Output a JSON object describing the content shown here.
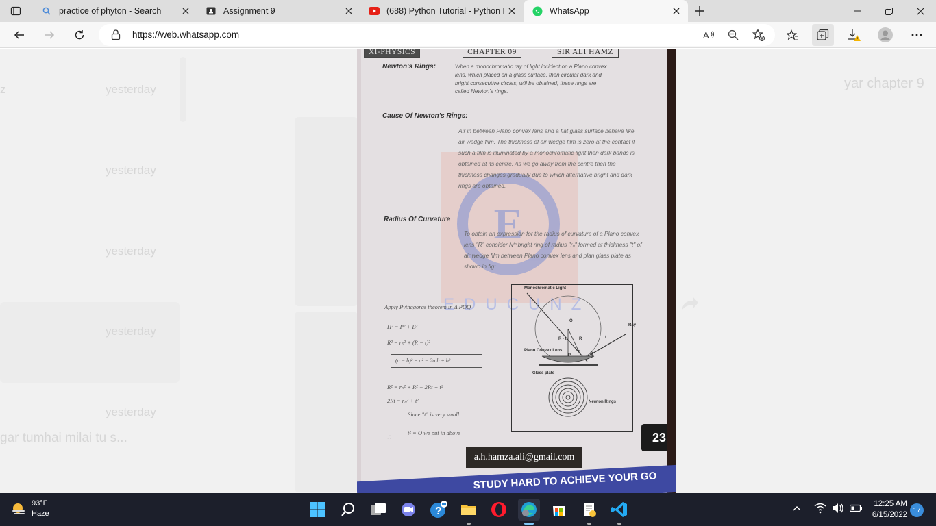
{
  "tabs": [
    {
      "title": "practice of phyton - Search",
      "icon": "search-icon"
    },
    {
      "title": "Assignment 9",
      "icon": "assignment-icon"
    },
    {
      "title": "(688) Python Tutorial - Python Fu",
      "icon": "youtube-icon"
    },
    {
      "title": "WhatsApp",
      "icon": "whatsapp-icon",
      "active": true
    }
  ],
  "address_bar": {
    "url": "https://web.whatsapp.com"
  },
  "background_chat": {
    "times": [
      "yesterday",
      "yesterday",
      "yesterday",
      "yesterday",
      "yesterday"
    ],
    "preview_left": "gar tumhai milai tu s...",
    "preview_right": "yar chapter 9",
    "left_edge_char": "z"
  },
  "document": {
    "header": [
      "XI-PHYSICS",
      "CHAPTER 09",
      "SIR ALI HAMZ"
    ],
    "newtons_rings_heading": "Newton's Rings:",
    "newtons_rings_text": "When a monochromatic ray of light incident on a Plano convex lens, which placed on a glass surface, then circular dark and bright consecutive circles, will be obtained, these rings are called Newton's rings.",
    "cause_heading": "Cause Of Newton's Rings:",
    "cause_text": "Air in between Plano convex lens and a flat glass surface behave like air wedge film. The thickness of air wedge film is zero at the contact if such a film is illuminated by a monochromatic light then dark bands is obtained at its centre. As we go away from the centre then the thickness changes gradually due to which alternative bright and dark rings are obtained.",
    "radius_heading": "Radius Of Curvature",
    "radius_text": "To obtain an expression for the radius of curvature of a Plano convex lens \"R\" consider Nᵗʰ bright ring of radius \"rₙ\" formed at thickness \"t\" of air wedge film between Plano convex lens and plan glass plate as shown in fig:",
    "pythagoras": "Apply Pythagoras theorem in Δ POQ",
    "eq1": "H² = P² + B²",
    "eq2": "R² = rₙ² + (R − t)²",
    "boxed": "(a − b)² = a² − 2a b + b²",
    "eq3": "R² = rₙ² + R² − 2Rt + t²",
    "eq4": "2Rt = rₙ² + t²",
    "since": "Since \"t\" is very small",
    "therefore_symbol": "∴",
    "t2": "t² = O  we put in above",
    "fig_labels": {
      "light": "Monochromatic Light",
      "lens": "Plano Convex Lens",
      "glass": "Glass plate",
      "rings": "Newton Rings",
      "o": "O",
      "r_minus_t": "R - t",
      "r": "R",
      "t": "t",
      "ray": "Ray",
      "rn": "rₙ",
      "p": "P",
      "q": "Q"
    },
    "watermark_letter": "E",
    "watermark_word": "EDUCUNZ",
    "page_number": "23",
    "email": "a.h.hamza.ali@gmail.com",
    "slogan": "STUDY HARD TO ACHIEVE YOUR GO"
  },
  "taskbar": {
    "weather_temp": "93°F",
    "weather_desc": "Haze",
    "time": "12:25 AM",
    "date": "6/15/2022",
    "notification_count": "17"
  }
}
